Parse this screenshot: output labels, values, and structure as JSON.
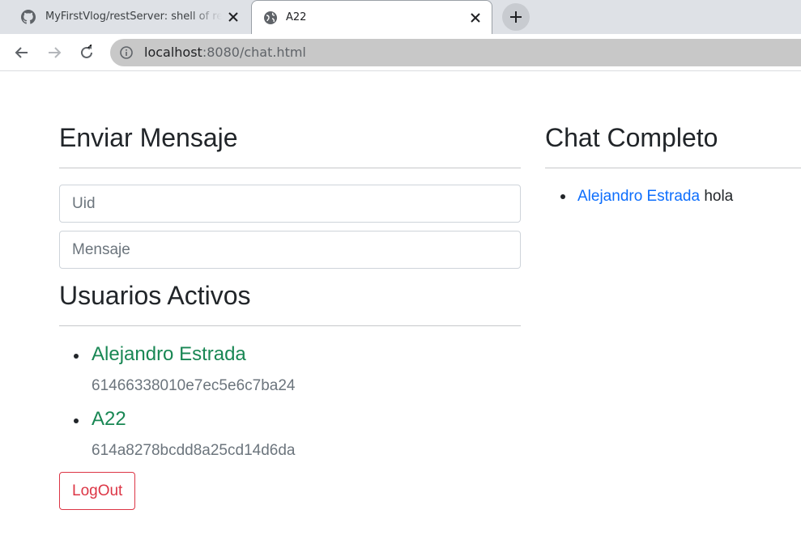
{
  "browser": {
    "tabs": [
      {
        "title": "MyFirstVlog/restServer: shell of rest server",
        "icon": "github-icon"
      },
      {
        "title": "A22",
        "icon": "globe-icon"
      }
    ],
    "address": {
      "host": "localhost",
      "path": ":8080/chat.html"
    }
  },
  "send": {
    "title": "Enviar Mensaje",
    "uid_placeholder": "Uid",
    "message_placeholder": "Mensaje"
  },
  "users": {
    "title": "Usuarios Activos",
    "list": [
      {
        "name": "Alejandro Estrada",
        "uid": "61466338010e7ec5e6c7ba24"
      },
      {
        "name": "A22",
        "uid": "614a8278bcdd8a25cd14d6da"
      }
    ]
  },
  "logout_label": "LogOut",
  "chat": {
    "title": "Chat Completo",
    "messages": [
      {
        "from": "Alejandro Estrada",
        "text": "hola"
      }
    ]
  },
  "colors": {
    "user_name": "#198754",
    "message_author": "#0d6efd",
    "logout": "#dc3545"
  }
}
